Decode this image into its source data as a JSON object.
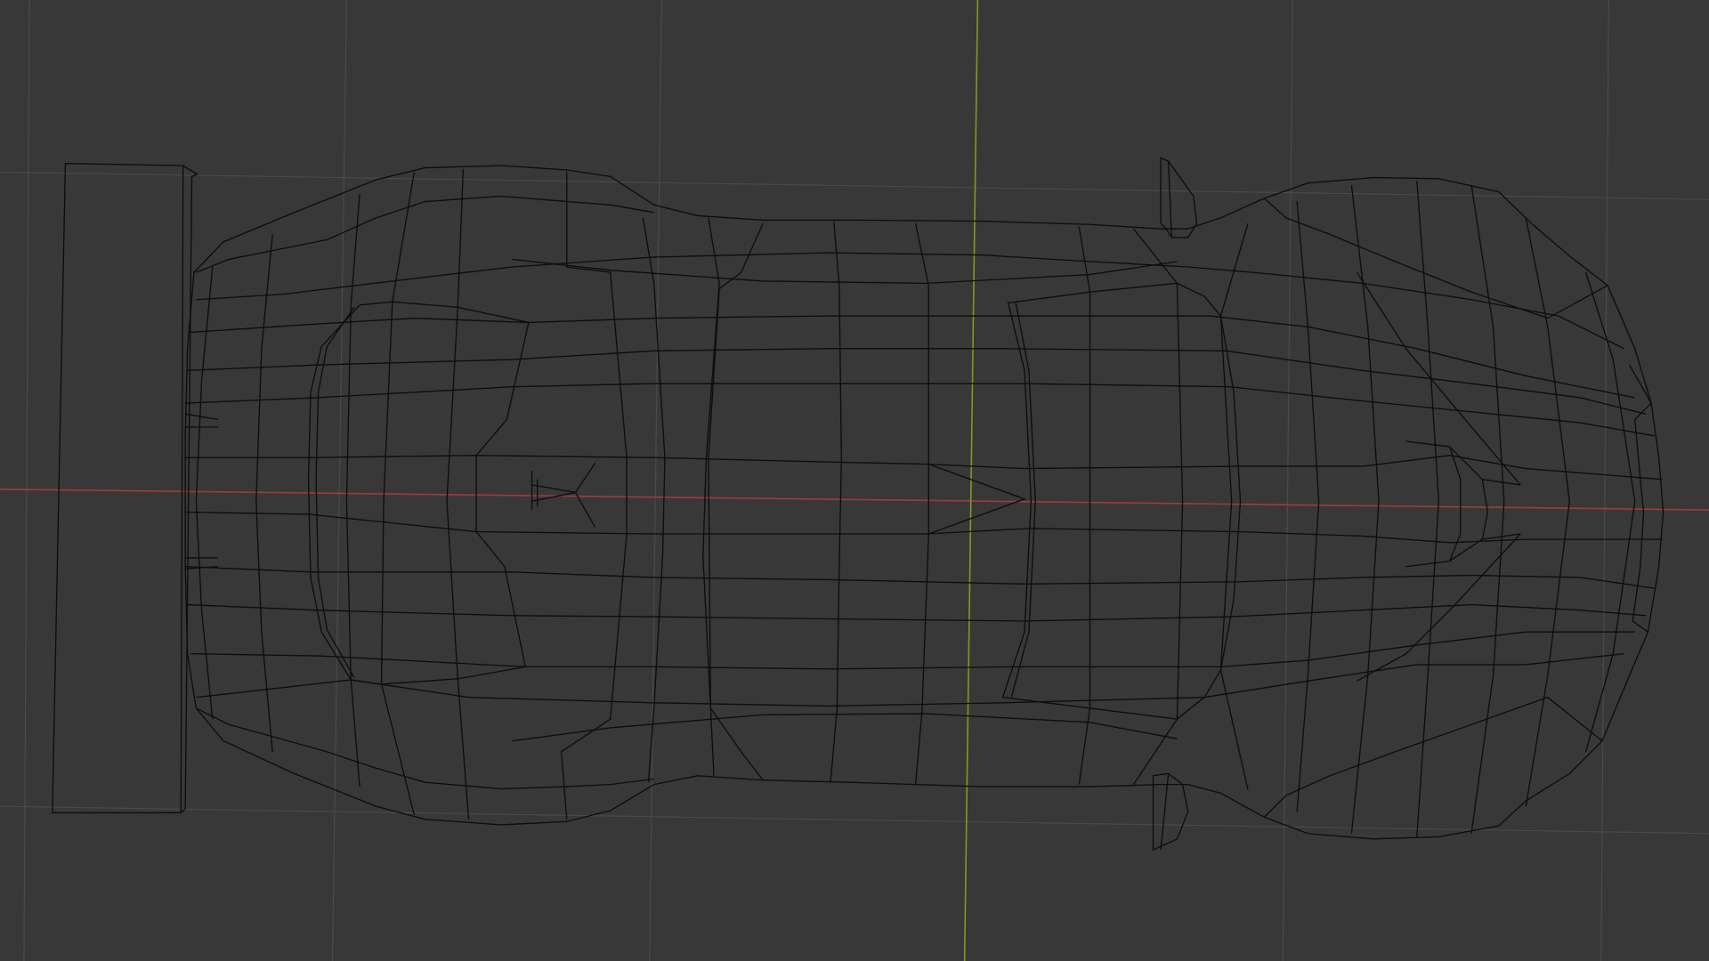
{
  "viewport": {
    "background_color": "#383838",
    "grid_color": "#4a4a4a",
    "x_axis_color": "#a33a3a",
    "y_axis_color": "#7d9b1e",
    "wire_color": "#0d0d0d",
    "view": "top",
    "object": "car-wireframe-mesh"
  }
}
